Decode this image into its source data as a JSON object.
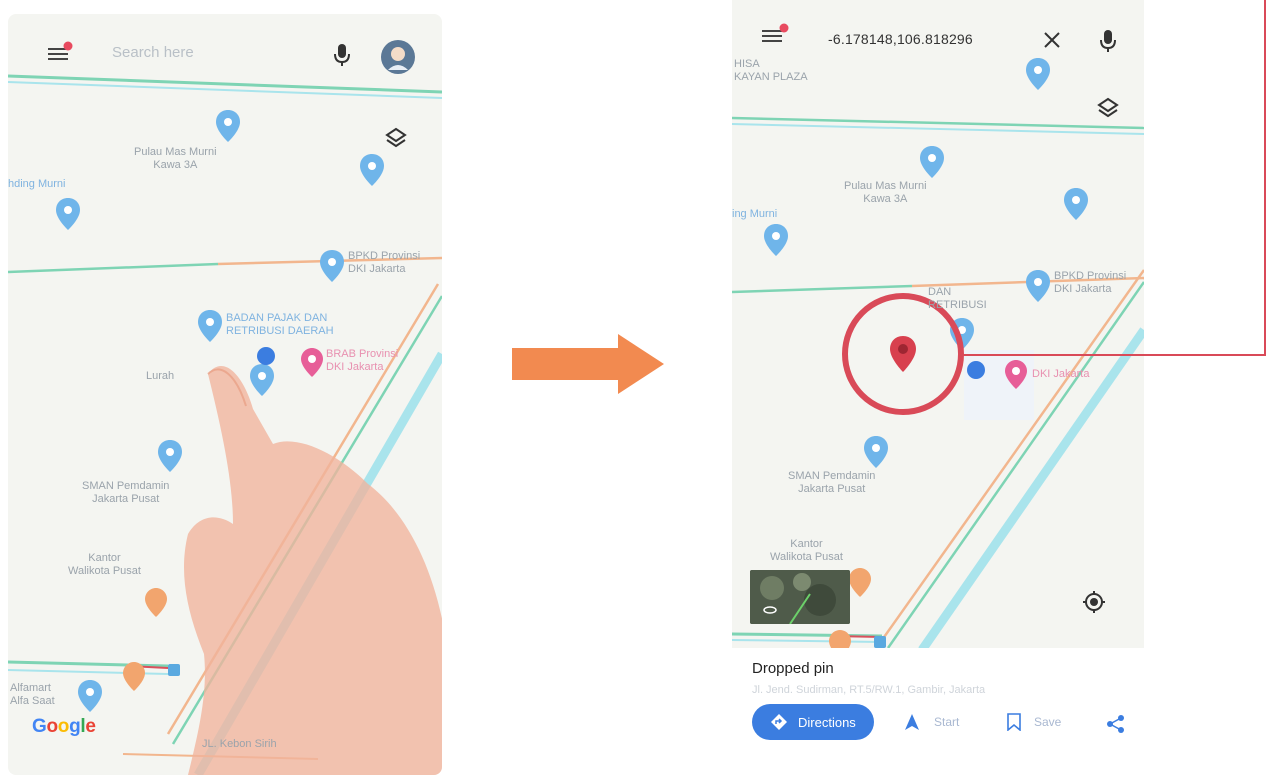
{
  "left_screen": {
    "search_placeholder": "Search here",
    "poi_labels": {
      "pulau_mas": "Pulau Mas Murni\nKawa 3A",
      "hding_murni": "hding Murni",
      "bpkd_top": "BPKD Provinsi\nDKI Jakarta",
      "badan_pajak": "BADAN PAJAK DAN\nRETRIBUSI DAERAH",
      "brab": "BRAB Provinsi\nDKI Jakarta",
      "lurah": "Lurah",
      "sma": "SMAN Pemdamin\nJakarta Pusat",
      "kantor": "Kantor\nWalikota Pusat",
      "alfamart": "Alfamart\nAlfa Saat",
      "jln_bawah": "JL. Kebon Sirih"
    },
    "google_logo": "Google",
    "colors": {
      "map_bg": "#f4f5f1",
      "road_green": "#7ed4b4",
      "road_orange": "#f2b68e",
      "road_cyan": "#a9e4ec",
      "pin_blue": "#6fb5ea",
      "pin_pink": "#e75e98"
    },
    "icons": [
      "menu-icon",
      "notification-dot",
      "mic-icon",
      "avatar",
      "layers-icon",
      "hand-image"
    ]
  },
  "transition_arrow": {
    "color": "#f28a50"
  },
  "right_screen": {
    "coordinates": "-6.178148,106.818296",
    "poi_labels": {
      "top_name": "HISA\nKAYAN PLAZA",
      "pulau_mas": "Pulau Mas Murni\nKawa 3A",
      "hding_murni": "ing Murni",
      "bpkd": "BPKD Provinsi\nDKI Jakarta",
      "retribusi": "DAN\nRETRIBUSI",
      "dki": "DKI Jakarta",
      "sma": "SMAN Pemdamin\nJakarta Pusat",
      "kantor": "Kantor\nWalikota Pusat"
    },
    "dropped_pin_title": "Dropped pin",
    "dropped_pin_address": "Jl. Jend. Sudirman, RT.5/RW.1, Gambir, Jakarta",
    "actions": {
      "directions": "Directions",
      "start": "Start",
      "save": "Save"
    },
    "colors": {
      "pin_red": "#d8404e",
      "highlight_circle": "#d94a58",
      "directions_bg": "#3b7de0"
    },
    "icons": [
      "menu-icon",
      "notification-dot",
      "close-icon",
      "mic-icon",
      "layers-icon",
      "location-pin-icon",
      "my-location-icon",
      "satellite-thumbnail",
      "directions-icon",
      "navigate-arrow-icon",
      "bookmark-icon",
      "share-icon"
    ]
  }
}
